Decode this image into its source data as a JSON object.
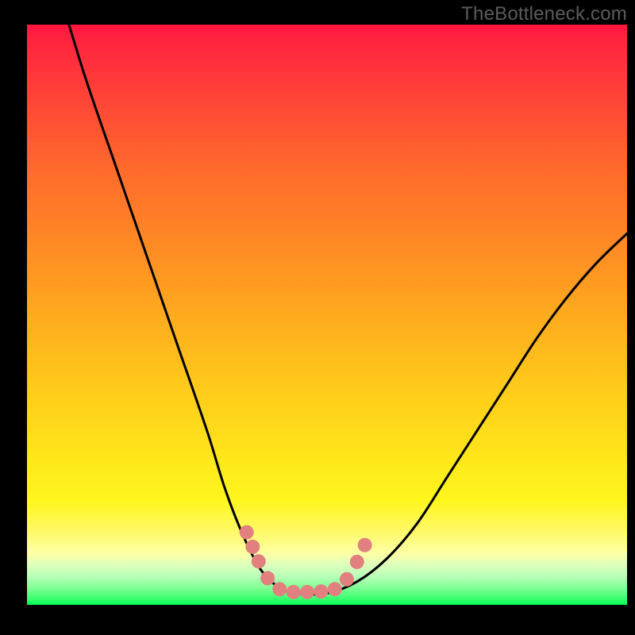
{
  "watermark": "TheBottleneck.com",
  "chart_data": {
    "type": "line",
    "title": "",
    "xlabel": "",
    "ylabel": "",
    "xlim": [
      0,
      100
    ],
    "ylim": [
      0,
      100
    ],
    "grid": false,
    "legend": false,
    "series": [
      {
        "name": "bottleneck-curve",
        "color": "#000000",
        "x": [
          7,
          10,
          15,
          20,
          25,
          30,
          33,
          36,
          39,
          42,
          45,
          50,
          55,
          60,
          65,
          70,
          75,
          80,
          85,
          90,
          95,
          100
        ],
        "y": [
          100,
          90,
          75,
          60,
          45,
          30,
          20,
          12,
          6,
          3,
          2,
          2,
          4,
          8,
          14,
          22,
          30,
          38,
          46,
          53,
          59,
          64
        ]
      }
    ],
    "markers": [
      {
        "name": "range-markers",
        "shape": "circle",
        "color": "#e28080",
        "radius_px": 9,
        "points": [
          {
            "x": 36.6,
            "y": 12.5
          },
          {
            "x": 37.6,
            "y": 10.0
          },
          {
            "x": 38.6,
            "y": 7.5
          },
          {
            "x": 40.1,
            "y": 4.6
          },
          {
            "x": 42.1,
            "y": 2.7
          },
          {
            "x": 44.4,
            "y": 2.2
          },
          {
            "x": 46.7,
            "y": 2.2
          },
          {
            "x": 49.0,
            "y": 2.3
          },
          {
            "x": 51.3,
            "y": 2.7
          },
          {
            "x": 53.3,
            "y": 4.4
          },
          {
            "x": 55.0,
            "y": 7.4
          },
          {
            "x": 56.3,
            "y": 10.3
          }
        ]
      }
    ],
    "background_gradient_stops": [
      {
        "pos": 0.0,
        "color": "#ff143e"
      },
      {
        "pos": 0.13,
        "color": "#ff4536"
      },
      {
        "pos": 0.25,
        "color": "#ff6a2c"
      },
      {
        "pos": 0.38,
        "color": "#ff8a24"
      },
      {
        "pos": 0.5,
        "color": "#ffaa1e"
      },
      {
        "pos": 0.62,
        "color": "#ffc91a"
      },
      {
        "pos": 0.74,
        "color": "#ffe51a"
      },
      {
        "pos": 0.82,
        "color": "#fff61d"
      },
      {
        "pos": 0.91,
        "color": "#ffffa3"
      },
      {
        "pos": 0.95,
        "color": "#baffba"
      },
      {
        "pos": 1.0,
        "color": "#00ff54"
      }
    ]
  }
}
